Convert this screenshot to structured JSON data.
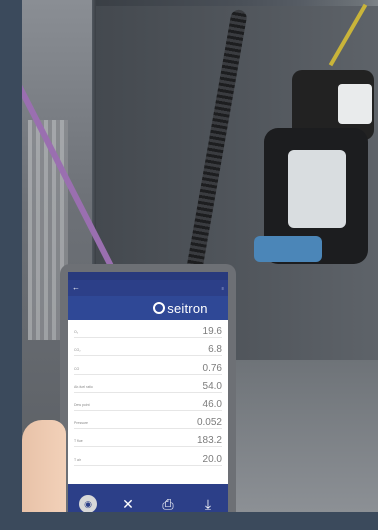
{
  "device": {
    "brand": "seitron",
    "rows": [
      {
        "label": "O₂",
        "value": "19.6"
      },
      {
        "label": "CO₂",
        "value": "6.8"
      },
      {
        "label": "CO",
        "value": "0.76"
      },
      {
        "label": "Air-fuel ratio",
        "value": "54.0"
      },
      {
        "label": "Dew point",
        "value": "46.0"
      },
      {
        "label": "Pressure",
        "value": "0.052"
      },
      {
        "label": "T flue",
        "value": "183.2"
      },
      {
        "label": "T air",
        "value": "20.0"
      }
    ],
    "toolbar": [
      {
        "icon": "camera-icon",
        "glyph": "◉"
      },
      {
        "icon": "close-icon",
        "glyph": "✕"
      },
      {
        "icon": "printer-icon",
        "glyph": "⎙"
      },
      {
        "icon": "download-icon",
        "glyph": "⤓"
      }
    ]
  }
}
